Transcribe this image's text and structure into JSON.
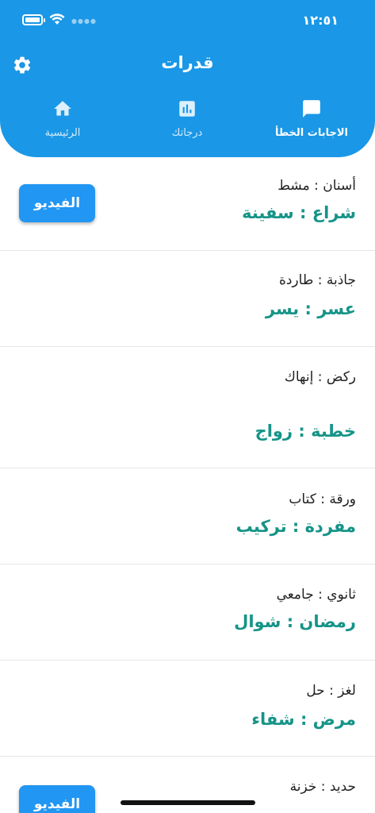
{
  "status_bar": {
    "time": "١٢:٥١"
  },
  "header": {
    "title": "قدرات"
  },
  "tabs": [
    {
      "label": "الاجابات الخطأ",
      "icon": "chat-bubble-icon",
      "active": true
    },
    {
      "label": "درجاتك",
      "icon": "bar-chart-icon",
      "active": false
    },
    {
      "label": "الرئيسية",
      "icon": "home-icon",
      "active": false
    }
  ],
  "items": [
    {
      "question": "أسنان : مشط",
      "answer": "شراع : سفينة",
      "video_label": "الفيديو"
    },
    {
      "question": "جاذبة : طاردة",
      "answer": "عسر : يسر"
    },
    {
      "question": "ركض : إنهاك",
      "answer": "خطبة : زواج"
    },
    {
      "question": "ورقة : كتاب",
      "answer": "مفردة : تركيب"
    },
    {
      "question": "ثانوي : جامعي",
      "answer": "رمضان : شوال"
    },
    {
      "question": "لغز : حل",
      "answer": "مرض : شفاء"
    },
    {
      "question": "حديد : خزنة",
      "answer": "",
      "video_label": "الفيديو"
    }
  ],
  "colors": {
    "header": "#1a97e6",
    "answer": "#169488",
    "video_button": "#2196f3"
  }
}
